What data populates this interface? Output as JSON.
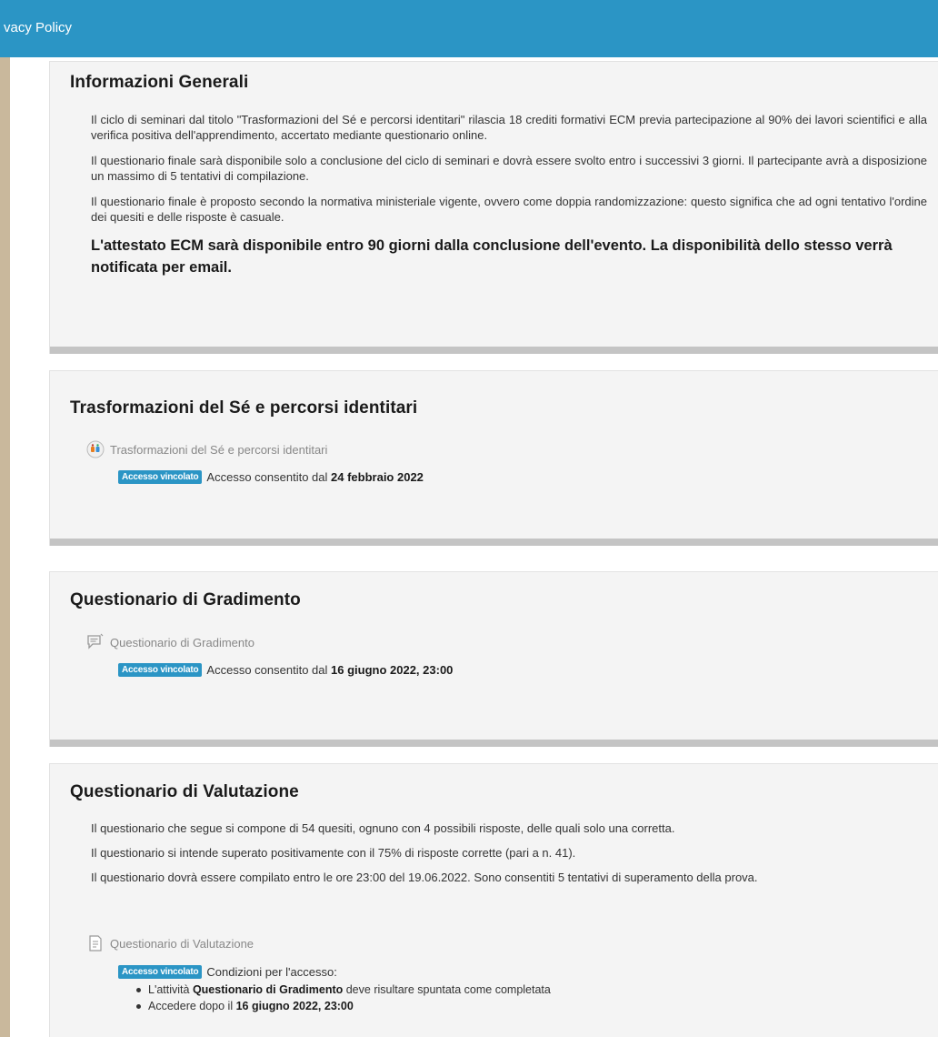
{
  "topbar": {
    "title": "vacy Policy"
  },
  "restriction_badge": "Accesso vincolato",
  "sections": {
    "info": {
      "title": "Informazioni Generali",
      "paragraphs": [
        "Il ciclo di seminari dal titolo \"Trasformazioni del Sé e percorsi identitari\" rilascia 18 crediti formativi ECM previa partecipazione al 90% dei lavori scientifici e alla verifica positiva dell'apprendimento, accertato mediante questionario online.",
        "Il questionario finale sarà disponibile solo a conclusione del ciclo di seminari e dovrà essere svolto entro i successivi 3 giorni. Il partecipante avrà a disposizione un massimo di 5 tentativi di compilazione.",
        "Il questionario finale è proposto secondo la normativa ministeriale vigente, ovvero come doppia randomizzazione: questo significa che ad ogni tentativo l'ordine dei quesiti e delle risposte è casuale."
      ],
      "note": "L'attestato ECM sarà disponibile entro 90 giorni dalla conclusione dell'evento. La disponibilità dello stesso verrà notificata per email."
    },
    "seminar": {
      "title": "Trasformazioni del Sé e percorsi identitari",
      "activity": {
        "label": "Trasformazioni del Sé e percorsi identitari",
        "icon": "video-conference-icon"
      },
      "restriction": {
        "text": "Accesso consentito dal",
        "date": "24 febbraio 2022"
      }
    },
    "satisfaction": {
      "title": "Questionario di Gradimento",
      "activity": {
        "label": "Questionario di Gradimento",
        "icon": "feedback-icon"
      },
      "restriction": {
        "text": "Accesso consentito dal",
        "date": "16 giugno 2022, 23:00"
      }
    },
    "evaluation": {
      "title": "Questionario di Valutazione",
      "paragraphs": [
        "Il questionario che segue si compone di 54 quesiti, ognuno con 4 possibili risposte, delle quali solo una corretta.",
        "Il questionario si intende superato positivamente con il 75% di risposte corrette (pari a n. 41).",
        "Il questionario dovrà essere compilato entro le ore 23:00 del 19.06.2022. Sono consentiti 5 tentativi di superamento della prova."
      ],
      "activity": {
        "label": "Questionario di Valutazione",
        "icon": "quiz-icon"
      },
      "restriction": {
        "text": "Condizioni per l'accesso:",
        "conditions": [
          {
            "pre": "L'attività",
            "bold": "Questionario di Gradimento",
            "post": "deve risultare spuntata come completata"
          },
          {
            "pre": "Accedere dopo il",
            "bold": "16 giugno 2022, 23:00",
            "post": ""
          }
        ]
      }
    }
  },
  "colors": {
    "topbar": "#2b95c5",
    "badge": "#2b95c5",
    "page_bg": "#c9b89c",
    "section_bg": "#f4f4f4"
  }
}
